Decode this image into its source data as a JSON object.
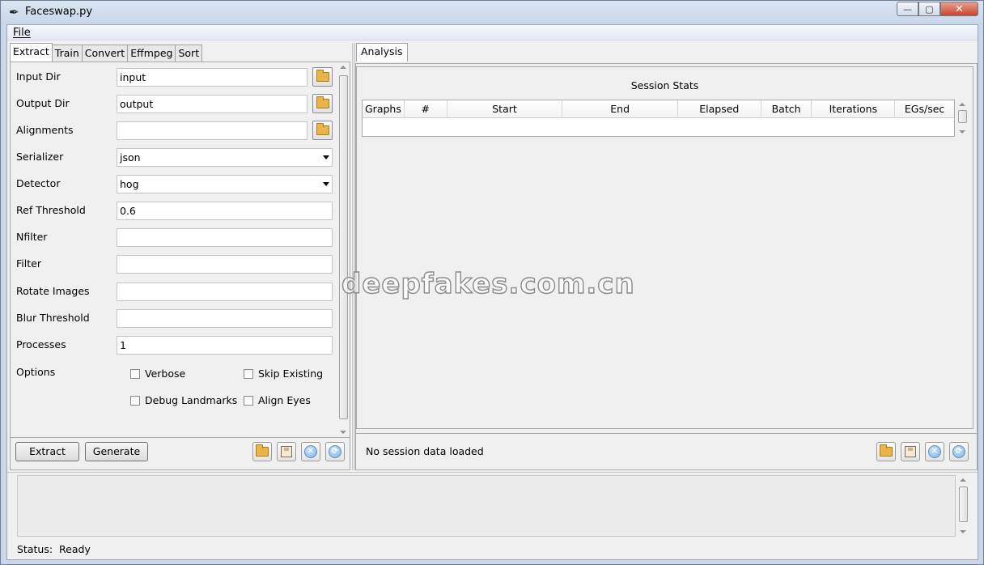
{
  "window": {
    "title": "Faceswap.py",
    "icon": "feather-icon"
  },
  "menubar": {
    "file": "File"
  },
  "left_tabs": [
    "Extract",
    "Train",
    "Convert",
    "Effmpeg",
    "Sort"
  ],
  "form": {
    "input_dir": {
      "label": "Input Dir",
      "value": "input"
    },
    "output_dir": {
      "label": "Output Dir",
      "value": "output"
    },
    "alignments": {
      "label": "Alignments",
      "value": ""
    },
    "serializer": {
      "label": "Serializer",
      "value": "json"
    },
    "detector": {
      "label": "Detector",
      "value": "hog"
    },
    "ref_threshold": {
      "label": "Ref Threshold",
      "value": "0.6"
    },
    "nfilter": {
      "label": "Nfilter",
      "value": ""
    },
    "filter": {
      "label": "Filter",
      "value": ""
    },
    "rotate_images": {
      "label": "Rotate Images",
      "value": ""
    },
    "blur_threshold": {
      "label": "Blur Threshold",
      "value": ""
    },
    "processes": {
      "label": "Processes",
      "value": "1"
    },
    "options": {
      "label": "Options",
      "verbose": "Verbose",
      "skip_existing": "Skip Existing",
      "debug_landmarks": "Debug Landmarks",
      "align_eyes": "Align Eyes"
    }
  },
  "actions": {
    "extract": "Extract",
    "generate": "Generate"
  },
  "right_tabs": [
    "Analysis"
  ],
  "analysis": {
    "title": "Session Stats",
    "columns": [
      "Graphs",
      "#",
      "Start",
      "End",
      "Elapsed",
      "Batch",
      "Iterations",
      "EGs/sec"
    ],
    "empty_message": "No session data loaded"
  },
  "watermark": "deepfakes.com.cn",
  "status": {
    "label": "Status:",
    "value": "Ready"
  }
}
